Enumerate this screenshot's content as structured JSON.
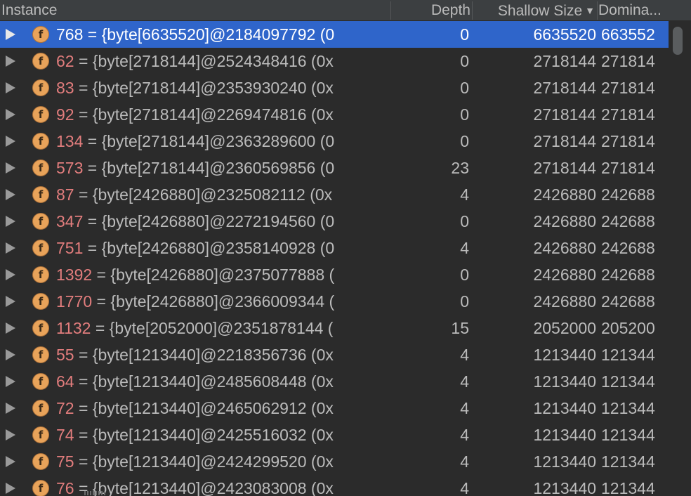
{
  "columns": {
    "instance": "Instance",
    "depth": "Depth",
    "shallow_size": "Shallow Size",
    "sort_indicator": "▼",
    "dominating": "Domina..."
  },
  "field_icon_letter": "f",
  "colors": {
    "background": "#2b2b2b",
    "header": "#3c3f41",
    "selection": "#2f65ca",
    "index_text": "#e27d7d",
    "field_icon": "#e8a35a"
  },
  "rows": [
    {
      "index": "768",
      "rest": " = {byte[6635520]@2184097792 (0",
      "depth": "0",
      "shallow": "6635520",
      "dominating": "663552",
      "selected": true
    },
    {
      "index": "62",
      "rest": " = {byte[2718144]@2524348416 (0x",
      "depth": "0",
      "shallow": "2718144",
      "dominating": "271814"
    },
    {
      "index": "83",
      "rest": " = {byte[2718144]@2353930240 (0x",
      "depth": "0",
      "shallow": "2718144",
      "dominating": "271814"
    },
    {
      "index": "92",
      "rest": " = {byte[2718144]@2269474816 (0x",
      "depth": "0",
      "shallow": "2718144",
      "dominating": "271814"
    },
    {
      "index": "134",
      "rest": " = {byte[2718144]@2363289600 (0",
      "depth": "0",
      "shallow": "2718144",
      "dominating": "271814"
    },
    {
      "index": "573",
      "rest": " = {byte[2718144]@2360569856 (0",
      "depth": "23",
      "shallow": "2718144",
      "dominating": "271814"
    },
    {
      "index": "87",
      "rest": " = {byte[2426880]@2325082112 (0x",
      "depth": "4",
      "shallow": "2426880",
      "dominating": "242688"
    },
    {
      "index": "347",
      "rest": " = {byte[2426880]@2272194560 (0",
      "depth": "0",
      "shallow": "2426880",
      "dominating": "242688"
    },
    {
      "index": "751",
      "rest": " = {byte[2426880]@2358140928 (0",
      "depth": "4",
      "shallow": "2426880",
      "dominating": "242688"
    },
    {
      "index": "1392",
      "rest": " = {byte[2426880]@2375077888 (",
      "depth": "0",
      "shallow": "2426880",
      "dominating": "242688"
    },
    {
      "index": "1770",
      "rest": " = {byte[2426880]@2366009344 (",
      "depth": "0",
      "shallow": "2426880",
      "dominating": "242688"
    },
    {
      "index": "1132",
      "rest": " = {byte[2052000]@2351878144 (",
      "depth": "15",
      "shallow": "2052000",
      "dominating": "205200"
    },
    {
      "index": "55",
      "rest": " = {byte[1213440]@2218356736 (0x",
      "depth": "4",
      "shallow": "1213440",
      "dominating": "121344"
    },
    {
      "index": "64",
      "rest": " = {byte[1213440]@2485608448 (0x",
      "depth": "4",
      "shallow": "1213440",
      "dominating": "121344"
    },
    {
      "index": "72",
      "rest": " = {byte[1213440]@2465062912 (0x",
      "depth": "4",
      "shallow": "1213440",
      "dominating": "121344"
    },
    {
      "index": "74",
      "rest": " = {byte[1213440]@2425516032 (0x",
      "depth": "4",
      "shallow": "1213440",
      "dominating": "121344"
    },
    {
      "index": "75",
      "rest": " = {byte[1213440]@2424299520 (0x",
      "depth": "4",
      "shallow": "1213440",
      "dominating": "121344"
    },
    {
      "index": "76",
      "rest": " = {byte[1213440]@2423083008 (0x",
      "depth": "4",
      "shallow": "1213440",
      "dominating": "121344"
    }
  ]
}
